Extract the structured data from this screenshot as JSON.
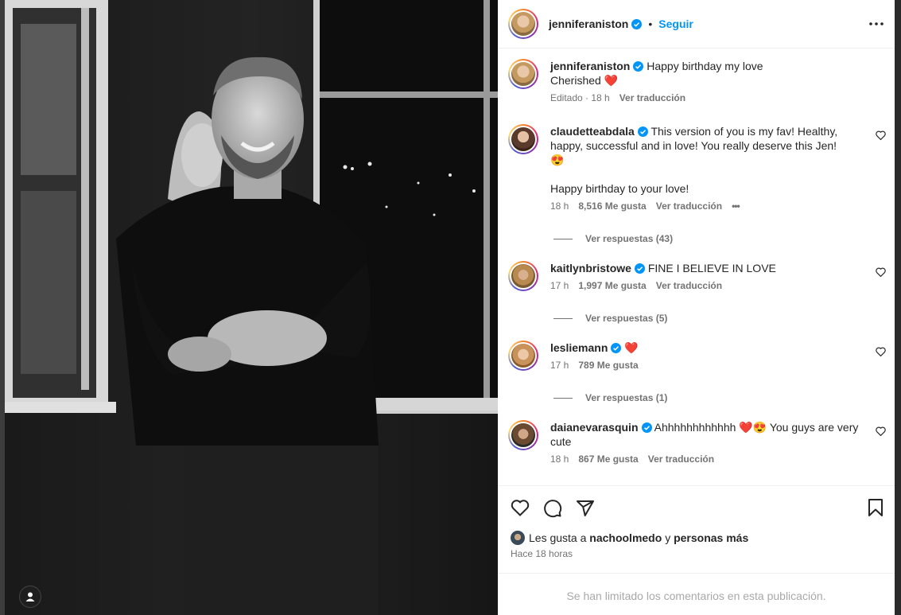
{
  "post": {
    "author": "jenniferaniston",
    "separator": "•",
    "follow_label": "Seguir"
  },
  "caption": {
    "username": "jenniferaniston",
    "line1": "Happy birthday my love",
    "line2": "Cherished",
    "emoji": "❤️",
    "meta_time": "Editado · 18 h",
    "translate": "Ver traducción"
  },
  "comments": [
    {
      "username": "claudetteabdala",
      "text1": "This version of you is my fav! Healthy, happy, successful and in love! You really deserve this Jen!",
      "emoji": "😍",
      "text2": "Happy birthday to your love!",
      "time": "18 h",
      "likes": "8,516 Me gusta",
      "translate": "Ver traducción",
      "more": "•••",
      "replies": "Ver respuestas (43)"
    },
    {
      "username": "kaitlynbristowe",
      "text": "FINE I BELIEVE IN LOVE",
      "time": "17 h",
      "likes": "1,997 Me gusta",
      "translate": "Ver traducción",
      "replies": "Ver respuestas (5)"
    },
    {
      "username": "lesliemann",
      "emoji": "❤️",
      "time": "17 h",
      "likes": "789 Me gusta",
      "replies": "Ver respuestas (1)"
    },
    {
      "username": "daianevarasquin",
      "text_a": "Ahhhhhhhhhhhh",
      "emoji": "❤️😍",
      "text_b": "You guys are very cute",
      "time": "18 h",
      "likes": "867 Me gusta",
      "translate": "Ver traducción"
    }
  ],
  "footer": {
    "likes_prefix": "Les gusta a",
    "likes_user": "nachoolmedo",
    "likes_mid": "y",
    "likes_rest": "personas más",
    "time": "Hace 18 horas",
    "limited": "Se han limitado los comentarios en esta publicación."
  },
  "colors": {
    "accent": "#0095f6",
    "verified": "#0095f6",
    "text": "#262626",
    "secondary": "#737373"
  },
  "icons": [
    "verified-icon",
    "more-options-icon",
    "heart-icon",
    "comment-icon",
    "share-icon",
    "bookmark-icon",
    "profile-icon"
  ]
}
